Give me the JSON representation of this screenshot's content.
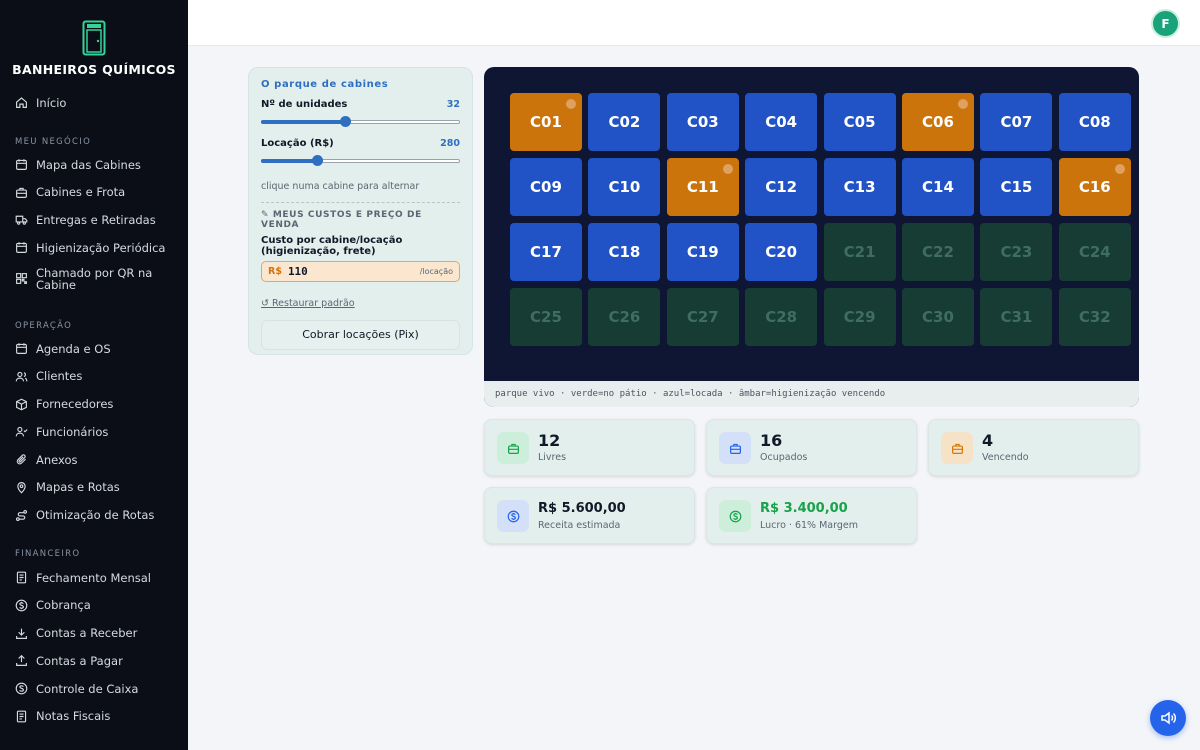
{
  "brand": {
    "name": "BANHEIROS QUÍMICOS"
  },
  "nav": {
    "home": {
      "label": "Início",
      "icon": "home-icon"
    },
    "section_business": "MEU NEGÓCIO",
    "business": [
      {
        "label": "Mapa das Cabines",
        "icon": "calendar-icon"
      },
      {
        "label": "Cabines e Frota",
        "icon": "briefcase-icon"
      },
      {
        "label": "Entregas e Retiradas",
        "icon": "truck-icon"
      },
      {
        "label": "Higienização Periódica",
        "icon": "calendar-icon"
      },
      {
        "label": "Chamado por QR na Cabine",
        "icon": "qr-icon"
      }
    ],
    "section_ops": "OPERAÇÃO",
    "ops": [
      {
        "label": "Agenda e OS",
        "icon": "calendar-icon"
      },
      {
        "label": "Clientes",
        "icon": "users-icon"
      },
      {
        "label": "Fornecedores",
        "icon": "box-icon"
      },
      {
        "label": "Funcionários",
        "icon": "user-check-icon"
      },
      {
        "label": "Anexos",
        "icon": "paperclip-icon"
      },
      {
        "label": "Mapas e Rotas",
        "icon": "map-pin-icon"
      },
      {
        "label": "Otimização de Rotas",
        "icon": "route-icon"
      }
    ],
    "section_fin": "FINANCEIRO",
    "fin": [
      {
        "label": "Fechamento Mensal",
        "icon": "document-icon"
      },
      {
        "label": "Cobrança",
        "icon": "dollar-circle-icon"
      },
      {
        "label": "Contas a Receber",
        "icon": "download-icon"
      },
      {
        "label": "Contas a Pagar",
        "icon": "upload-icon"
      },
      {
        "label": "Controle de Caixa",
        "icon": "cash-icon"
      },
      {
        "label": "Notas Fiscais",
        "icon": "document-icon"
      }
    ]
  },
  "user": {
    "initial": "F"
  },
  "panel": {
    "title": "O parque de cabines",
    "units_label": "Nº de unidades",
    "units_value": "32",
    "units_fraction": 0.42,
    "rent_label": "Locação (R$)",
    "rent_value": "280",
    "rent_fraction": 0.28,
    "hint": "clique numa cabine para alternar",
    "costs_title": "✎ MEUS CUSTOS E PREÇO DE VENDA",
    "cost_label": "Custo por cabine/locação (higienização, frete)",
    "currency": "R$",
    "cost_value": "110",
    "cost_unit": "/locação",
    "restore": "↺ Restaurar padrão",
    "pix_button": "Cobrar locações (Pix)"
  },
  "yard": {
    "legend": "parque vivo · verde=no pátio · azul=locada · âmbar=higienização vencendo",
    "cabins": [
      {
        "id": "C01",
        "status": "vencendo"
      },
      {
        "id": "C02",
        "status": "locada"
      },
      {
        "id": "C03",
        "status": "locada"
      },
      {
        "id": "C04",
        "status": "locada"
      },
      {
        "id": "C05",
        "status": "locada"
      },
      {
        "id": "C06",
        "status": "vencendo"
      },
      {
        "id": "C07",
        "status": "locada"
      },
      {
        "id": "C08",
        "status": "locada"
      },
      {
        "id": "C09",
        "status": "locada"
      },
      {
        "id": "C10",
        "status": "locada"
      },
      {
        "id": "C11",
        "status": "vencendo"
      },
      {
        "id": "C12",
        "status": "locada"
      },
      {
        "id": "C13",
        "status": "locada"
      },
      {
        "id": "C14",
        "status": "locada"
      },
      {
        "id": "C15",
        "status": "locada"
      },
      {
        "id": "C16",
        "status": "vencendo"
      },
      {
        "id": "C17",
        "status": "locada"
      },
      {
        "id": "C18",
        "status": "locada"
      },
      {
        "id": "C19",
        "status": "locada"
      },
      {
        "id": "C20",
        "status": "locada"
      },
      {
        "id": "C21",
        "status": "livre"
      },
      {
        "id": "C22",
        "status": "livre"
      },
      {
        "id": "C23",
        "status": "livre"
      },
      {
        "id": "C24",
        "status": "livre"
      },
      {
        "id": "C25",
        "status": "livre"
      },
      {
        "id": "C26",
        "status": "livre"
      },
      {
        "id": "C27",
        "status": "livre"
      },
      {
        "id": "C28",
        "status": "livre"
      },
      {
        "id": "C29",
        "status": "livre"
      },
      {
        "id": "C30",
        "status": "livre"
      },
      {
        "id": "C31",
        "status": "livre"
      },
      {
        "id": "C32",
        "status": "livre"
      }
    ]
  },
  "stats": {
    "livres": {
      "value": "12",
      "label": "Livres",
      "icon": "briefcase-icon",
      "color": "#16a34a"
    },
    "ocupados": {
      "value": "16",
      "label": "Ocupados",
      "icon": "briefcase-icon",
      "color": "#2563eb"
    },
    "vencendo": {
      "value": "4",
      "label": "Vencendo",
      "icon": "briefcase-icon",
      "color": "#d97706"
    },
    "receita": {
      "value": "R$ 5.600,00",
      "label": "Receita estimada",
      "icon": "dollar-circle-icon",
      "color": "#2563eb"
    },
    "lucro": {
      "value": "R$ 3.400,00",
      "label": "Lucro · 61% Margem",
      "icon": "dollar-circle-icon",
      "color": "#16a34a"
    }
  },
  "colors": {
    "accent": "#2f6fc1",
    "locada": "#2153c6",
    "vencendo": "#cc740c",
    "livre": "#163c33",
    "profit": "#16a34a"
  }
}
